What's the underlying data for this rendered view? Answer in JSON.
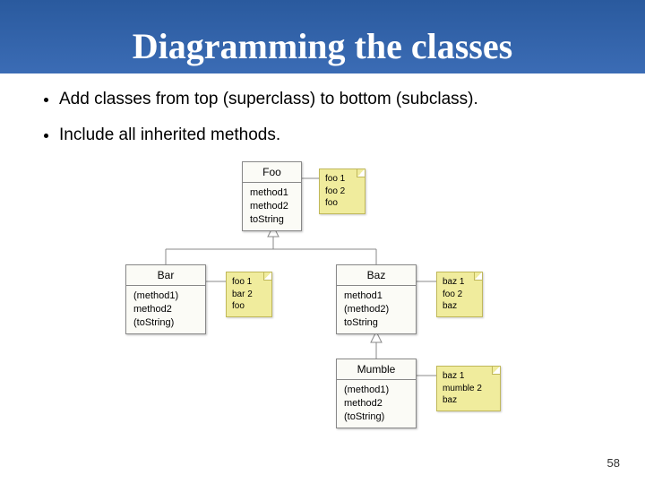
{
  "header": {
    "title": "Diagramming the classes"
  },
  "bullets": {
    "item1": "Add classes from top (superclass) to bottom (subclass).",
    "item2": "Include all inherited methods."
  },
  "classes": {
    "foo": {
      "name": "Foo",
      "methods": {
        "m1": "method1",
        "m2": "method2",
        "m3": "toString"
      },
      "note": {
        "l1": "foo 1",
        "l2": "foo 2",
        "l3": "foo"
      }
    },
    "bar": {
      "name": "Bar",
      "methods": {
        "m1": "(method1)",
        "m2": "method2",
        "m3": "(toString)"
      },
      "note": {
        "l1": "foo 1",
        "l2": "bar 2",
        "l3": "foo"
      }
    },
    "baz": {
      "name": "Baz",
      "methods": {
        "m1": "method1",
        "m2": "(method2)",
        "m3": "toString"
      },
      "note": {
        "l1": "baz 1",
        "l2": "foo 2",
        "l3": "baz"
      }
    },
    "mumble": {
      "name": "Mumble",
      "methods": {
        "m1": "(method1)",
        "m2": "method2",
        "m3": "(toString)"
      },
      "note": {
        "l1": "baz 1",
        "l2": "mumble 2",
        "l3": "baz"
      }
    }
  },
  "page": {
    "number": "58"
  }
}
